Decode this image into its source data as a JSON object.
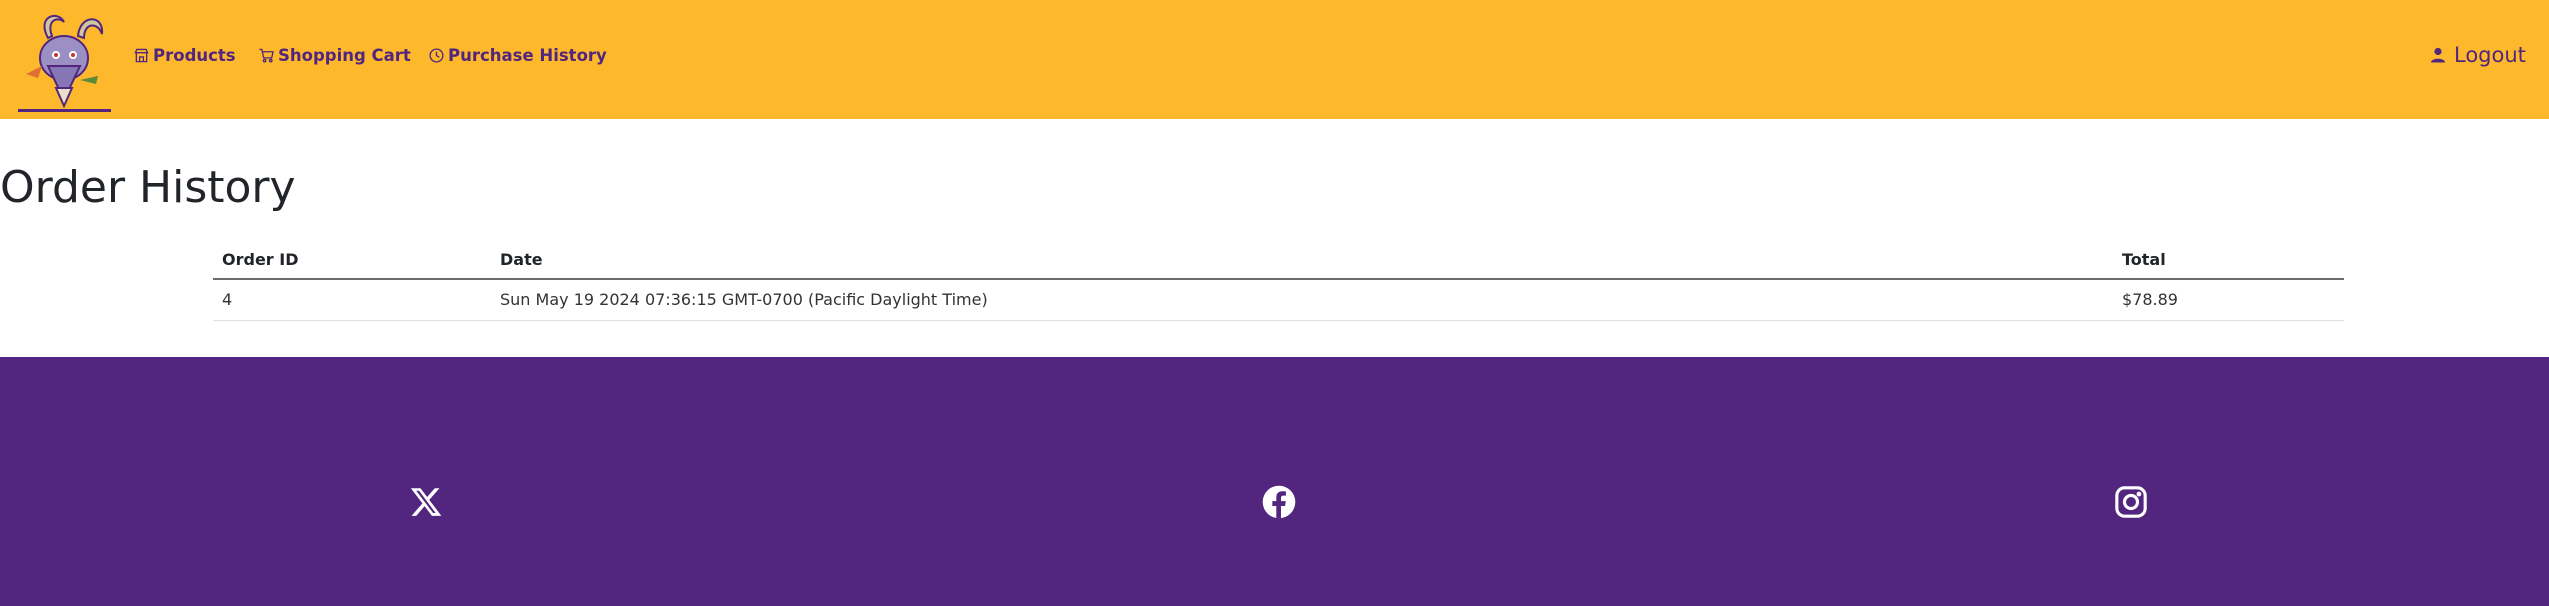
{
  "nav": {
    "products_label": "Products",
    "cart_label": "Shopping Cart",
    "history_label": "Purchase History",
    "logout_label": "Logout"
  },
  "page": {
    "title": "Order History"
  },
  "orders_table": {
    "headers": {
      "order_id": "Order ID",
      "date": "Date",
      "total": "Total"
    },
    "rows": [
      {
        "order_id": "4",
        "date": "Sun May 19 2024 07:36:15 GMT-0700 (Pacific Daylight Time)",
        "total": "$78.89"
      }
    ]
  },
  "footer": {
    "social_icons": [
      "x-icon",
      "facebook-icon",
      "instagram-icon"
    ]
  },
  "colors": {
    "header_bg": "#FDB82B",
    "brand_purple": "#52267f",
    "footer_bg": "#52267f"
  }
}
